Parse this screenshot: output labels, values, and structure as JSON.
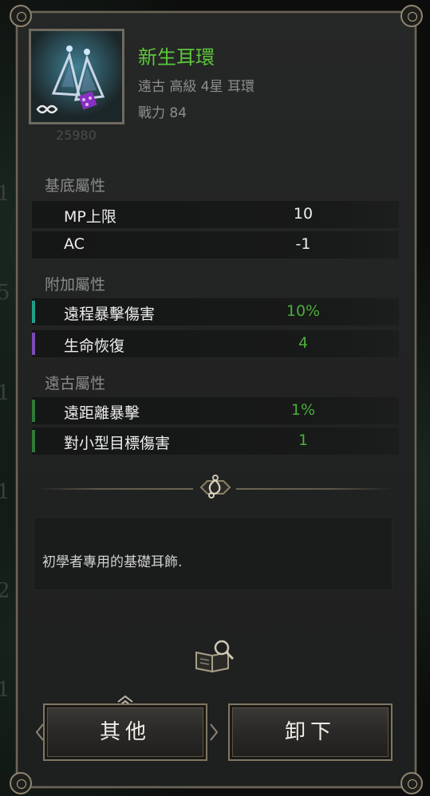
{
  "item": {
    "name": "新生耳環",
    "subtitle": "遠古 高級 4星 耳環",
    "power": "戰力 84",
    "faded_number": "25980",
    "name_color": "#5cc63b"
  },
  "background_numbers": [
    "1",
    "5",
    "1",
    "1",
    "2",
    "1"
  ],
  "sections": {
    "base": {
      "title": "基底屬性",
      "rows": [
        {
          "label": "MP上限",
          "value": "10"
        },
        {
          "label": "AC",
          "value": "-1"
        }
      ]
    },
    "extra": {
      "title": "附加屬性",
      "rows": [
        {
          "label": "遠程暴擊傷害",
          "value": "10%",
          "bar_color": "#1e9f88"
        },
        {
          "label": "生命恢復",
          "value": "4",
          "bar_color": "#7b4ab8"
        }
      ]
    },
    "ancient": {
      "title": "遠古屬性",
      "rows": [
        {
          "label": "遠距離暴擊",
          "value": "1%",
          "bar_color": "#2e7a3a"
        },
        {
          "label": "對小型目標傷害",
          "value": "1",
          "bar_color": "#2e7a3a"
        }
      ]
    }
  },
  "description": "初學者專用的基礎耳飾.",
  "buttons": {
    "other": "其他",
    "unequip": "卸下"
  },
  "icons": {
    "divider": "earring-emblem-icon",
    "lookup": "book-search-icon"
  },
  "colors": {
    "value_green": "#4cae3a",
    "panel_border": "#6b6558"
  }
}
